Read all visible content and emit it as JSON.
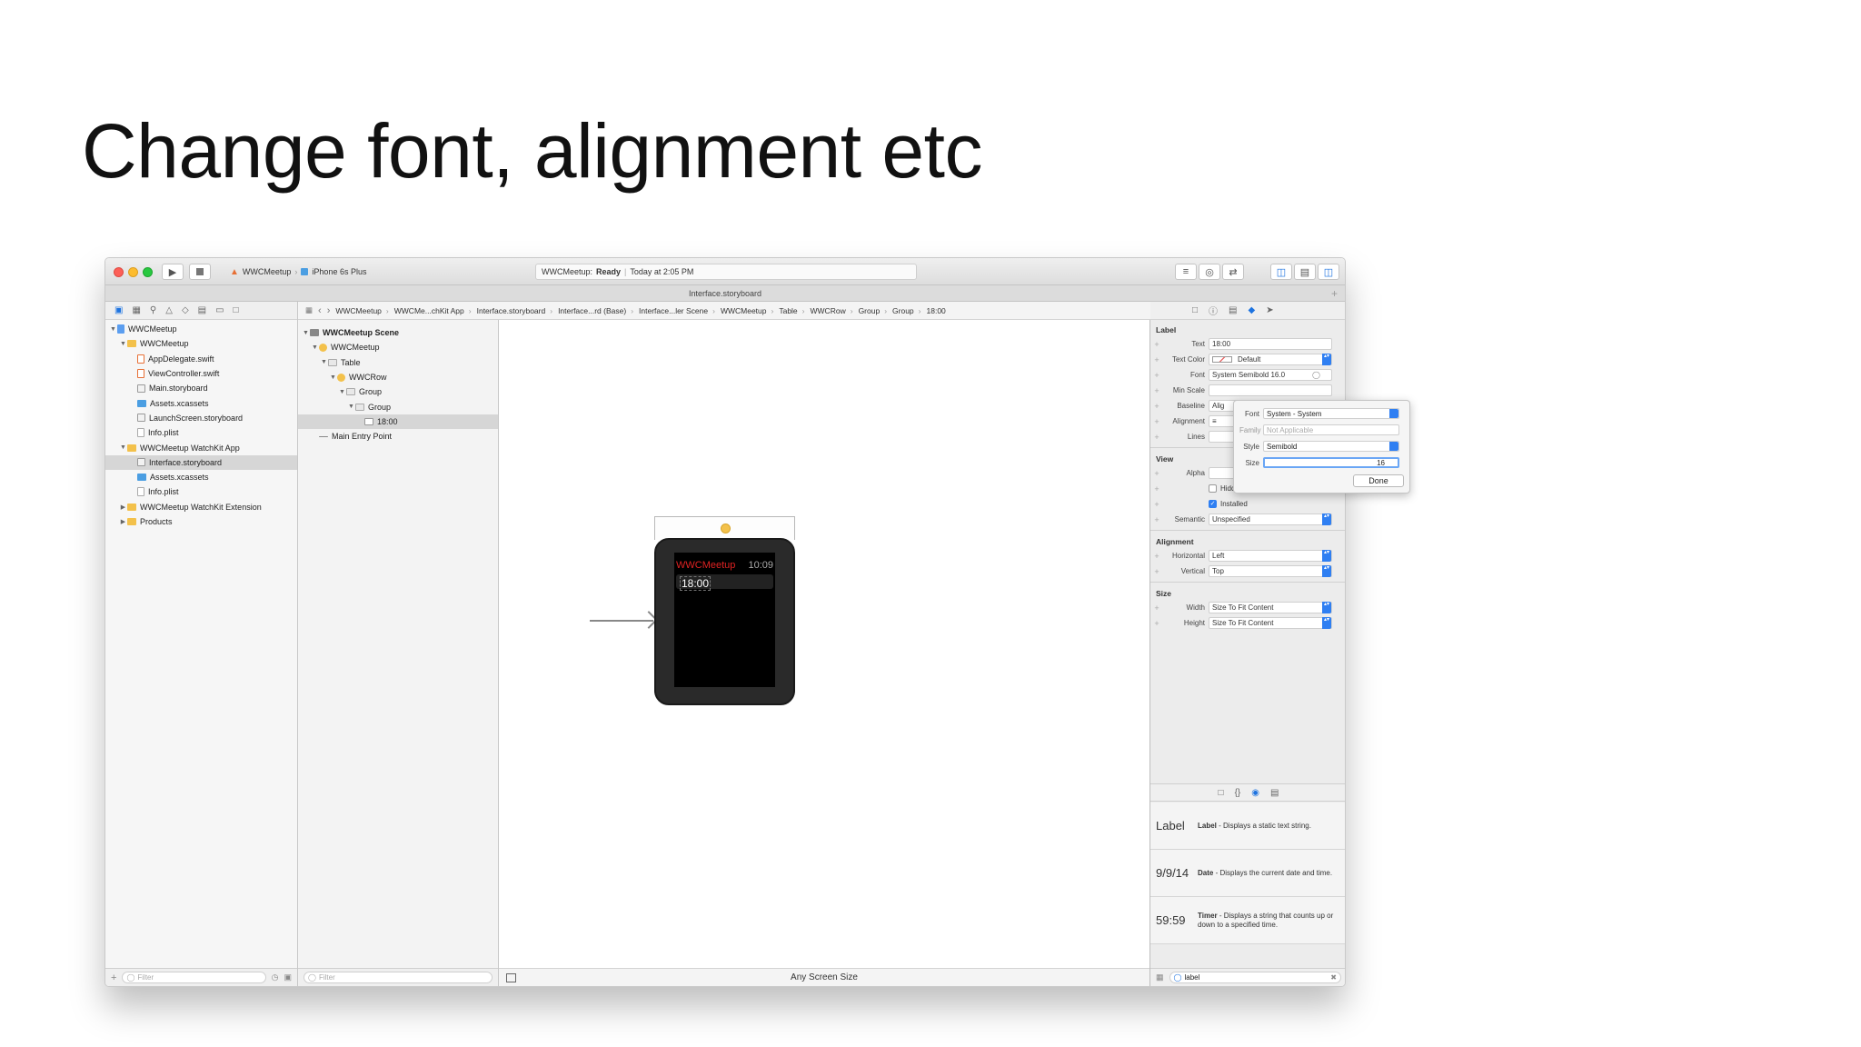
{
  "slide": {
    "title": "Change font, alignment etc"
  },
  "toolbar": {
    "scheme_target": "WWCMeetup",
    "scheme_device": "iPhone 6s Plus",
    "status_app": "WWCMeetup:",
    "status_state": "Ready",
    "status_time": "Today at 2:05 PM"
  },
  "tabbar": {
    "title": "Interface.storyboard"
  },
  "navigator": {
    "items": [
      {
        "label": "WWCMeetup",
        "depth": 0,
        "kind": "proj",
        "disc": "▼"
      },
      {
        "label": "WWCMeetup",
        "depth": 1,
        "kind": "folder",
        "disc": "▼"
      },
      {
        "label": "AppDelegate.swift",
        "depth": 2,
        "kind": "swift",
        "disc": ""
      },
      {
        "label": "ViewController.swift",
        "depth": 2,
        "kind": "swift",
        "disc": ""
      },
      {
        "label": "Main.storyboard",
        "depth": 2,
        "kind": "sb",
        "disc": ""
      },
      {
        "label": "Assets.xcassets",
        "depth": 2,
        "kind": "assets",
        "disc": ""
      },
      {
        "label": "LaunchScreen.storyboard",
        "depth": 2,
        "kind": "sb",
        "disc": ""
      },
      {
        "label": "Info.plist",
        "depth": 2,
        "kind": "file",
        "disc": ""
      },
      {
        "label": "WWCMeetup WatchKit App",
        "depth": 1,
        "kind": "folder",
        "disc": "▼"
      },
      {
        "label": "Interface.storyboard",
        "depth": 2,
        "kind": "sb",
        "disc": "",
        "selected": true
      },
      {
        "label": "Assets.xcassets",
        "depth": 2,
        "kind": "assets",
        "disc": ""
      },
      {
        "label": "Info.plist",
        "depth": 2,
        "kind": "file",
        "disc": ""
      },
      {
        "label": "WWCMeetup WatchKit Extension",
        "depth": 1,
        "kind": "folder",
        "disc": "▶"
      },
      {
        "label": "Products",
        "depth": 1,
        "kind": "folder",
        "disc": "▶"
      }
    ],
    "filter_placeholder": "Filter"
  },
  "jumpbar": {
    "crumbs": [
      "WWCMeetup",
      "WWCMe...chKit App",
      "Interface.storyboard",
      "Interface...rd (Base)",
      "Interface...ler Scene",
      "WWCMeetup",
      "Table",
      "WWCRow",
      "Group",
      "Group",
      "18:00"
    ]
  },
  "outline": {
    "items": [
      {
        "label": "WWCMeetup Scene",
        "depth": 0,
        "disc": "▼",
        "bold": true
      },
      {
        "label": "WWCMeetup",
        "depth": 1,
        "disc": "▼"
      },
      {
        "label": "Table",
        "depth": 2,
        "disc": "▼"
      },
      {
        "label": "WWCRow",
        "depth": 3,
        "disc": "▼"
      },
      {
        "label": "Group",
        "depth": 4,
        "disc": "▼"
      },
      {
        "label": "Group",
        "depth": 5,
        "disc": "▼"
      },
      {
        "label": "18:00",
        "depth": 6,
        "disc": "",
        "selected": true
      },
      {
        "label": "Main Entry Point",
        "depth": 1,
        "disc": ""
      }
    ],
    "filter_placeholder": "Filter"
  },
  "canvas": {
    "watch_title": "WWCMeetup",
    "watch_clock": "10:09",
    "watch_label": "18:00",
    "size_class": "Any Screen Size"
  },
  "inspector": {
    "label_section": "Label",
    "text_label": "Text",
    "text_value": "18:00",
    "text_color_label": "Text Color",
    "text_color_value": "Default",
    "font_label": "Font",
    "font_value": "System Semibold 16.0",
    "min_scale_label": "Min Scale",
    "baseline_label": "Baseline",
    "baseline_value": "Alig",
    "alignment_label": "Alignment",
    "lines_label": "Lines",
    "view_section": "View",
    "alpha_label": "Alpha",
    "hidden_label": "Hidden",
    "installed_label": "Installed",
    "semantic_label": "Semantic",
    "semantic_value": "Unspecified",
    "alignment_section": "Alignment",
    "horizontal_label": "Horizontal",
    "horizontal_value": "Left",
    "vertical_label": "Vertical",
    "vertical_value": "Top",
    "size_section": "Size",
    "width_label": "Width",
    "width_value": "Size To Fit Content",
    "height_label": "Height",
    "height_value": "Size To Fit Content"
  },
  "font_popover": {
    "font_label": "Font",
    "font_value": "System - System",
    "family_label": "Family",
    "family_value": "Not Applicable",
    "style_label": "Style",
    "style_value": "Semibold",
    "size_label": "Size",
    "size_value": "16",
    "done_label": "Done"
  },
  "library": {
    "items": [
      {
        "glyph": "Label",
        "name": "Label",
        "desc": " - Displays a static text string."
      },
      {
        "glyph": "9/9/14",
        "name": "Date",
        "desc": " - Displays the current date and time."
      },
      {
        "glyph": "59:59",
        "name": "Timer",
        "desc": " - Displays a string that counts up or down to a specified time."
      }
    ],
    "search_value": "label"
  },
  "colors": {
    "accent": "#2f7ff2",
    "watch_title": "#e02222",
    "folder": "#f3c14b"
  }
}
